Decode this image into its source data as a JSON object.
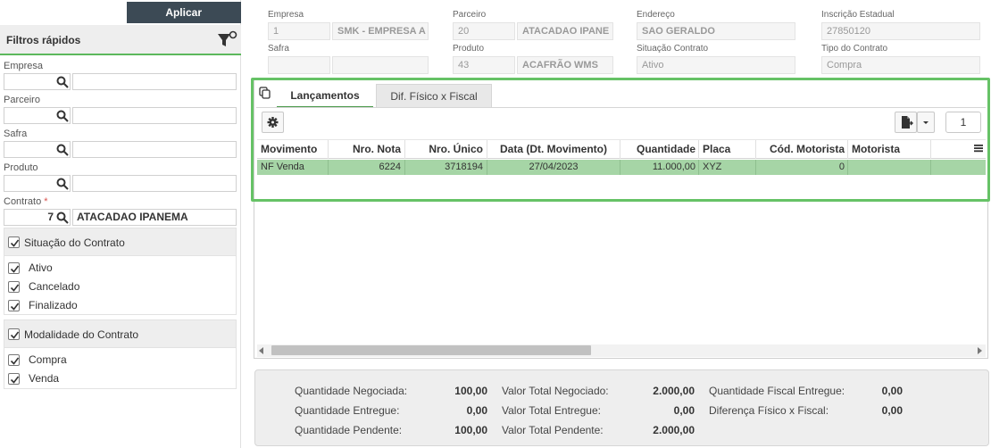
{
  "sidebar": {
    "apply_label": "Aplicar",
    "filters_title": "Filtros rápidos",
    "empresa": {
      "label": "Empresa",
      "code": "",
      "description": ""
    },
    "parceiro": {
      "label": "Parceiro",
      "code": "",
      "description": ""
    },
    "safra": {
      "label": "Safra",
      "code": "",
      "description": ""
    },
    "produto": {
      "label": "Produto",
      "code": "",
      "description": ""
    },
    "contrato": {
      "label": "Contrato",
      "required_mark": "*",
      "code": "7",
      "description": "ATACADAO IPANEMA"
    },
    "situacao": {
      "title": "Situação do Contrato",
      "options": [
        {
          "label": "Ativo",
          "checked": true
        },
        {
          "label": "Cancelado",
          "checked": true
        },
        {
          "label": "Finalizado",
          "checked": true
        }
      ]
    },
    "modalidade": {
      "title": "Modalidade do Contrato",
      "options": [
        {
          "label": "Compra",
          "checked": true
        },
        {
          "label": "Venda",
          "checked": true
        }
      ]
    }
  },
  "header": {
    "empresa": {
      "label": "Empresa",
      "code": "1",
      "name": "SMK - EMPRESA A"
    },
    "parceiro": {
      "label": "Parceiro",
      "code": "20",
      "name": "ATACADAO IPANE"
    },
    "endereco": {
      "label": "Endereço",
      "value": "SAO GERALDO"
    },
    "inscricao": {
      "label": "Inscrição Estadual",
      "value": "27850120"
    },
    "safra": {
      "label": "Safra",
      "code": "",
      "name": ""
    },
    "produto": {
      "label": "Produto",
      "code": "43",
      "name": "ACAFRÃO WMS"
    },
    "situacao": {
      "label": "Situação Contrato",
      "value": "Ativo"
    },
    "tipo": {
      "label": "Tipo do Contrato",
      "value": "Compra"
    }
  },
  "tabs": [
    {
      "label": "Lançamentos",
      "active": true
    },
    {
      "label": "Dif. Físico x Fiscal",
      "active": false
    }
  ],
  "toolbar": {
    "page_number": "1"
  },
  "grid": {
    "columns": [
      "Movimento",
      "Nro. Nota",
      "Nro. Único",
      "Data (Dt. Movimento)",
      "Quantidade",
      "Placa",
      "Cód. Motorista",
      "Motorista"
    ],
    "rows": [
      {
        "movimento": "NF Venda",
        "nro_nota": "6224",
        "nro_unico": "3718194",
        "data": "27/04/2023",
        "quantidade": "11.000,00",
        "placa": "XYZ",
        "cod_motorista": "0",
        "motorista": ""
      }
    ]
  },
  "totals": {
    "qtd_negociada": {
      "label": "Quantidade Negociada:",
      "value": "100,00"
    },
    "qtd_entregue": {
      "label": "Quantidade Entregue:",
      "value": "0,00"
    },
    "qtd_pendente": {
      "label": "Quantidade Pendente:",
      "value": "100,00"
    },
    "valor_negociado": {
      "label": "Valor Total Negociado:",
      "value": "2.000,00"
    },
    "valor_entregue": {
      "label": "Valor Total Entregue:",
      "value": "0,00"
    },
    "valor_pendente": {
      "label": "Valor Total Pendente:",
      "value": "2.000,00"
    },
    "qtd_fiscal_entregue": {
      "label": "Quantidade Fiscal Entregue:",
      "value": "0,00"
    },
    "diferenca": {
      "label": "Diferença Físico x Fiscal:",
      "value": "0,00"
    }
  },
  "colors": {
    "accent_green": "#66c266",
    "selected_row": "#a6d5a6",
    "apply_button": "#3c4a55"
  }
}
